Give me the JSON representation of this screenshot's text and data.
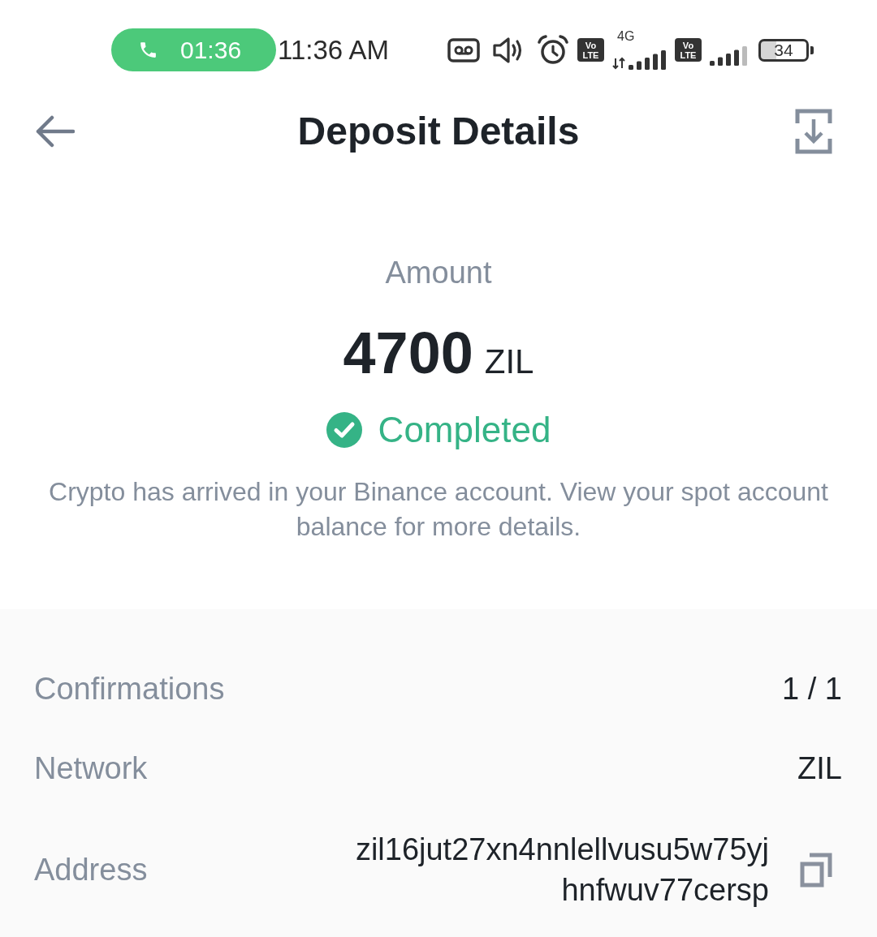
{
  "status_bar": {
    "call_timer": "01:36",
    "time": "11:36 AM",
    "sims": [
      {
        "badge_top": "Vo",
        "badge_bottom": "LTE",
        "network_type": "4G"
      },
      {
        "badge_top": "Vo",
        "badge_bottom": "LTE"
      }
    ],
    "battery": "34"
  },
  "header": {
    "title": "Deposit Details"
  },
  "summary": {
    "label": "Amount",
    "amount": "4700",
    "currency": "ZIL",
    "status": {
      "kind": "completed",
      "label": "Completed"
    },
    "message": "Crypto has arrived in your Binance account. View your spot account balance for more details."
  },
  "details": [
    {
      "kind": "text",
      "label": "Confirmations",
      "value": "1 / 1"
    },
    {
      "kind": "text",
      "label": "Network",
      "value": "ZIL"
    },
    {
      "kind": "copyable",
      "label": "Address",
      "value": "zil16jut27xn4nnlellvusu5w75yjhnfwuv77cersp"
    }
  ]
}
